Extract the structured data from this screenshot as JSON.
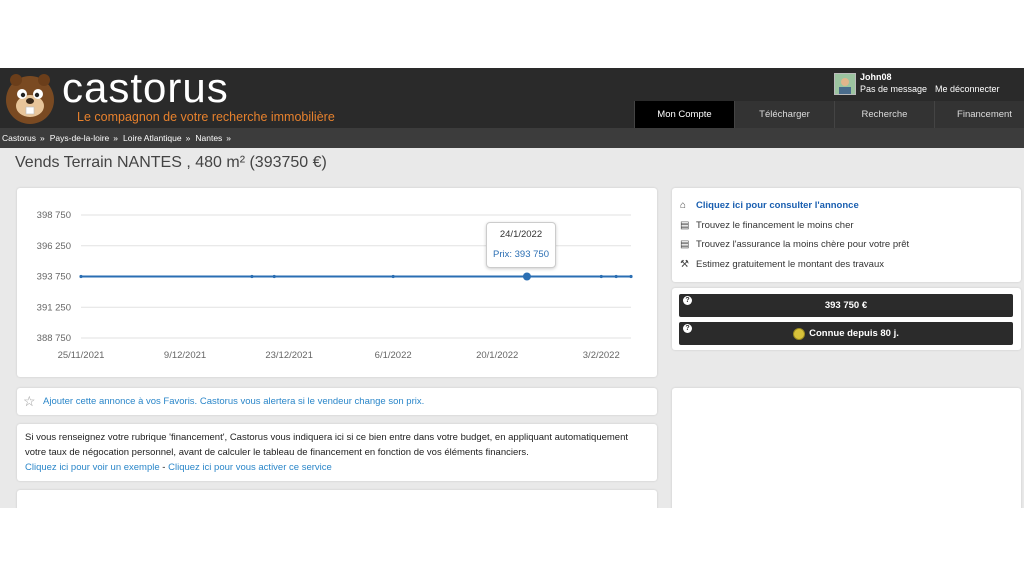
{
  "header": {
    "logo_text": "castorus",
    "tagline": "Le compagnon de votre recherche immobilière",
    "user_name": "John08",
    "user_message": "Pas de message",
    "logout_label": "Me déconnecter",
    "nav": [
      {
        "label": "Mon Compte",
        "active": true
      },
      {
        "label": "Télécharger",
        "active": false
      },
      {
        "label": "Recherche",
        "active": false
      },
      {
        "label": "Financement",
        "active": false
      }
    ]
  },
  "breadcrumb": [
    "Castorus",
    "Pays-de-la-loire",
    "Loire Atlantique",
    "Nantes"
  ],
  "breadcrumb_sep": "»",
  "page_title": "Vends Terrain NANTES , 480 m² (393750 €)",
  "chart_data": {
    "type": "line",
    "x_ticks": [
      "25/11/2021",
      "9/12/2021",
      "23/12/2021",
      "6/1/2022",
      "20/1/2022",
      "3/2/2022"
    ],
    "y_ticks": [
      "398 750",
      "396 250",
      "393 750",
      "391 250",
      "388 750"
    ],
    "ylim": [
      388750,
      398750
    ],
    "xlim": [
      "2021-11-25",
      "2022-02-07"
    ],
    "grid": true,
    "color": "#2a6eb3",
    "series": [
      {
        "points": [
          {
            "x": "2021-11-25",
            "y": 393750
          },
          {
            "x": "2021-12-18",
            "y": 393750
          },
          {
            "x": "2021-12-21",
            "y": 393750
          },
          {
            "x": "2022-01-06",
            "y": 393750
          },
          {
            "x": "2022-01-24",
            "y": 393750
          },
          {
            "x": "2022-02-03",
            "y": 393750
          },
          {
            "x": "2022-02-05",
            "y": 393750
          },
          {
            "x": "2022-02-07",
            "y": 393750
          }
        ]
      }
    ],
    "tooltip": {
      "date": "24/1/2022",
      "label": "Prix: 393 750",
      "x": "2022-01-24"
    }
  },
  "right_links": [
    {
      "label": "Cliquez ici pour consulter l'annonce",
      "icon": "home-icon",
      "primary": true
    },
    {
      "label": "Trouvez le financement le moins cher",
      "icon": "calculator-icon",
      "primary": false
    },
    {
      "label": "Trouvez l'assurance la moins chère pour votre prêt",
      "icon": "calculator-icon",
      "primary": false
    },
    {
      "label": "Estimez gratuitement le montant des travaux",
      "icon": "hammer-icon",
      "primary": false
    }
  ],
  "price_box": {
    "price": "393 750 €",
    "online_since": "Connue depuis 80 j."
  },
  "favorites_text": "Ajouter cette annonce à vos Favoris. Castorus vous alertera si le vendeur change son prix.",
  "financing": {
    "text": "Si vous renseignez votre rubrique 'financement', Castorus vous indiquera ici si ce bien entre dans votre budget, en appliquant automatiquement votre taux de négocation personnel, avant de calculer le tableau de financement en fonction de vos éléments financiers.",
    "link_example": "Cliquez ici pour voir un exemple",
    "separator": " - ",
    "link_activate": "Cliquez ici pour vous activer ce service"
  }
}
